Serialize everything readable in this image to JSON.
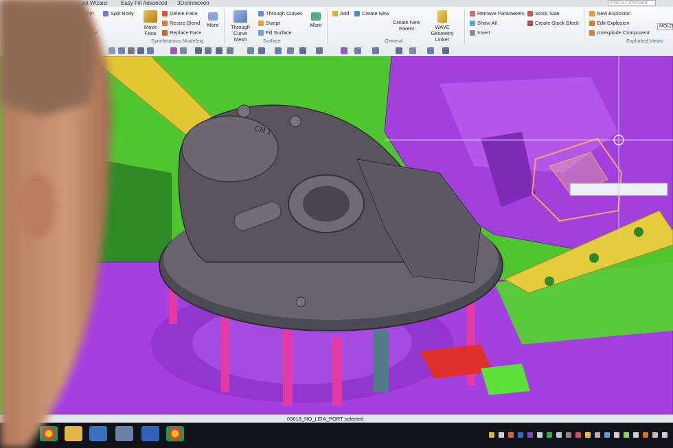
{
  "menubar": {
    "items": [
      "old Wizard",
      "Easy Fill Advanced",
      "3Dconnexion"
    ],
    "command_finder_placeholder": "Find a Command"
  },
  "ribbon": {
    "col1": {
      "items": [
        "mfer",
        "Body"
      ]
    },
    "split_body": "Split Body",
    "move_face": "Move Face",
    "delete_face": "Delete Face",
    "resize_blend": "Resize Blend",
    "replace_face": "Replace Face",
    "more_1": "More",
    "group_synchronous": "Synchronous Modeling",
    "through_curve_mesh": "Through Curve Mesh",
    "through_curves": "Through Curves",
    "swept": "Swept",
    "fill_surface": "Fill Surface",
    "more_2": "More",
    "group_surface": "Surface",
    "add": "Add",
    "create_new": "Create New",
    "create_new_parent": "Create New Parent",
    "wave_linker": "WAVE Geometry Linker",
    "group_general": "General",
    "remove_parameters": "Remove Parameters",
    "show_all": "Show All",
    "invert": "Invert",
    "stock_size": "Stock Size",
    "create_stock_block": "Create Stock Block",
    "new_explosion": "New Explosion",
    "edit_explosion": "Edit Explosion",
    "unexplode_component": "Unexplode Component",
    "group_exploded": "Exploded Views",
    "molding_field": "MOLD"
  },
  "viewport": {
    "part_label": "CN 1",
    "colors": {
      "background": "#4fc52f",
      "mold_base": "#a43fe0",
      "part": "#5e5b62",
      "pins": "#e33aa6",
      "rail": "#e3cb3c",
      "highlight": "#f2a463"
    }
  },
  "status": {
    "text": "03613_NO_LEIA_PORT  selected"
  },
  "taskbar": {
    "apps": [
      "chrome-icon",
      "files-icon",
      "settings-icon",
      "nx-icon",
      "chrome-icon"
    ]
  }
}
